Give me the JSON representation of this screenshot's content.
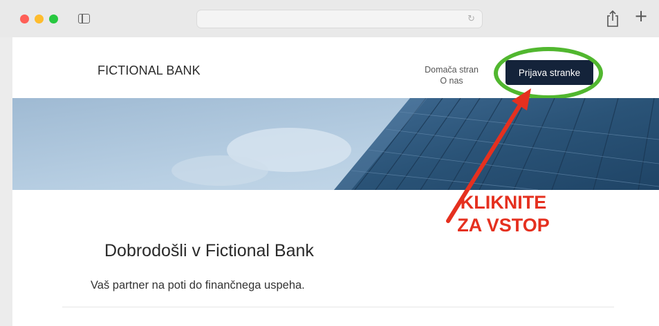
{
  "browser": {
    "address_placeholder": ""
  },
  "site": {
    "logo": "FICTIONAL BANK",
    "nav_links": "Domača stran O nas",
    "login_button": "Prijava stranke",
    "welcome_title": "Dobrodošli v Fictional Bank",
    "welcome_subtitle": "Vaš partner na poti do finančnega uspeha."
  },
  "annotation": {
    "line1": "KLIKNITE",
    "line2": "ZA VSTOP",
    "text_color": "#e5301f",
    "ring_color": "#51b72f",
    "arrow_color": "#e5301f"
  },
  "colors": {
    "button_bg": "#14233a",
    "sky": "#a9c4dc",
    "building": "#2a5377"
  },
  "icons": [
    "sidebar-icon",
    "reload-icon",
    "share-icon",
    "plus-icon"
  ]
}
